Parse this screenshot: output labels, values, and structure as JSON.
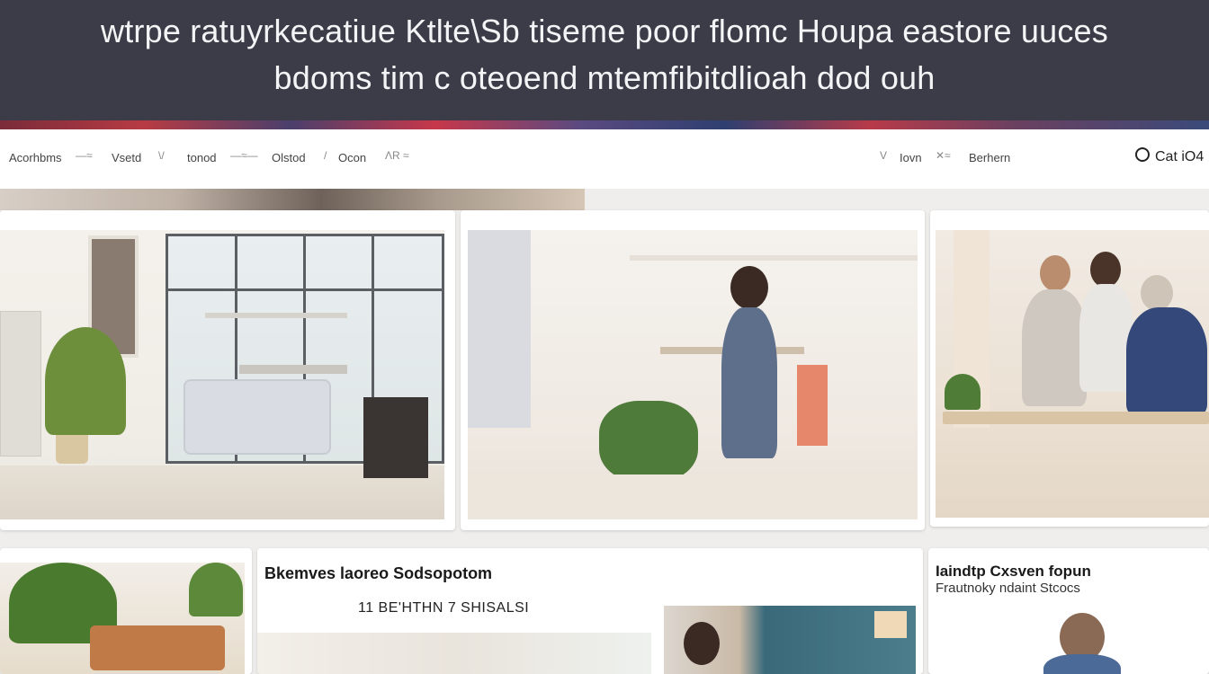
{
  "banner": {
    "line1": "wtrpe ratuyrkecatiue Ktlte\\Sb tiseme poor flomc Houpa eastore uuces",
    "line2": "bdoms tim c oteoend mtemfibitdlioah dod ouh"
  },
  "nav": {
    "items": [
      "Acorhbms",
      "Vsetd",
      "tonod",
      "Olstod",
      "Ocon"
    ],
    "right_items": [
      "Iovn",
      "Berhern"
    ],
    "search_label": "Cat iO4"
  },
  "bottom": {
    "middle_title": "Bkemves laoreo Sodsopotom",
    "middle_sub": "11 BE'HTHN 7 SHISALSI",
    "right_title": "Iaindtp Cxsven fopun",
    "right_sub": "Frautnoky ndaint Stcocs"
  },
  "icons": [
    "search-icon",
    "nav-dash-icon"
  ],
  "colors": {
    "banner": "#3b3c47",
    "page": "#ffffff",
    "backdrop": "#efeeec"
  }
}
